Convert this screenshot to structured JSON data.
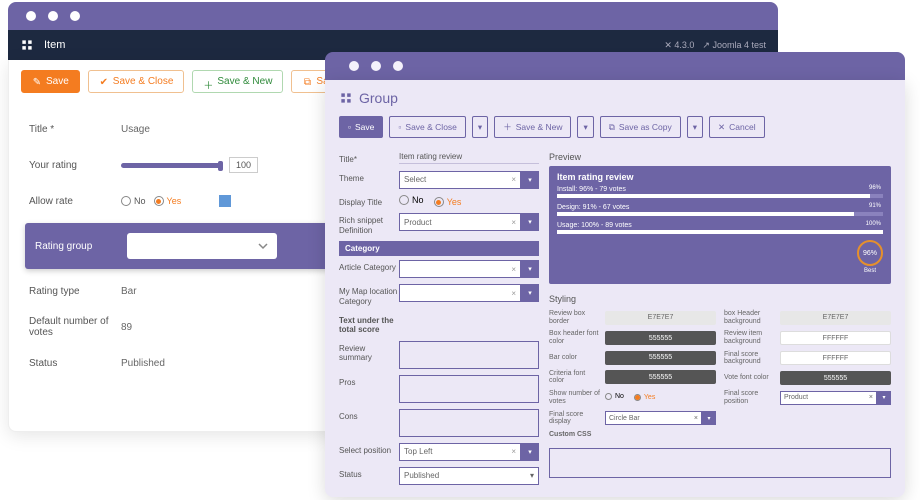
{
  "win1": {
    "header_title": "Item",
    "version": "4.3.0",
    "site_label": "Joomla 4 test",
    "toolbar": {
      "save": "Save",
      "save_close": "Save & Close",
      "save_new": "Save & New",
      "save_copy": "Save as Copy"
    },
    "form": {
      "title_lbl": "Title *",
      "title_val": "Usage",
      "rating_lbl": "Your rating",
      "rating_val": "100",
      "allow_lbl": "Allow rate",
      "no": "No",
      "yes": "Yes",
      "group_lbl": "Rating group",
      "type_lbl": "Rating type",
      "type_val": "Bar",
      "default_lbl": "Default number of votes",
      "default_val": "89",
      "status_lbl": "Status",
      "status_val": "Published"
    }
  },
  "win2": {
    "title": "Group",
    "toolbar": {
      "save": "Save",
      "save_close": "Save & Close",
      "save_new": "Save & New",
      "save_copy": "Save as Copy",
      "cancel": "Cancel"
    },
    "left": {
      "title_lbl": "Title*",
      "title_val": "Item rating review",
      "theme_lbl": "Theme",
      "theme_val": "Select",
      "disp_title_lbl": "Display Title",
      "no": "No",
      "yes": "Yes",
      "snippet_lbl": "Rich snippet Definition",
      "snippet_val": "Product",
      "category_hdr": "Category",
      "art_cat_lbl": "Article Category",
      "map_cat_lbl": "My Map location Category",
      "text_under_lbl": "Text under the total score",
      "summary_lbl": "Review summary",
      "pros_lbl": "Pros",
      "cons_lbl": "Cons",
      "selpos_lbl": "Select position",
      "selpos_val": "Top Left",
      "status_lbl": "Status",
      "status_val": "Published"
    },
    "preview": {
      "heading": "Preview",
      "title": "Item rating review",
      "rows": [
        {
          "label": "Install: 96% - 79 votes",
          "pct": "96%",
          "width": 96
        },
        {
          "label": "Design: 91% - 67 votes",
          "pct": "91%",
          "width": 91
        },
        {
          "label": "Usage: 100% - 89 votes",
          "pct": "100%",
          "width": 100
        }
      ],
      "gauge_val": "96%",
      "gauge_lbl": "Best"
    },
    "styling": {
      "heading": "Styling",
      "left": {
        "box_border_lbl": "Review box border",
        "box_border_val": "E7E7E7",
        "header_font_lbl": "Box header font color",
        "header_font_val": "555555",
        "bar_lbl": "Bar color",
        "bar_val": "555555",
        "criteria_lbl": "Criteria font color",
        "criteria_val": "555555",
        "show_votes_lbl": "Show number of votes",
        "no": "No",
        "yes": "Yes",
        "display_lbl": "Final score display",
        "display_val": "Circle Bar",
        "css_lbl": "Custom CSS"
      },
      "right": {
        "header_bg_lbl": "box Header background",
        "header_bg_val": "E7E7E7",
        "item_bg_lbl": "Review item background",
        "item_bg_val": "FFFFFF",
        "final_bg_lbl": "Final score background",
        "final_bg_val": "FFFFFF",
        "vote_font_lbl": "Vote font color",
        "vote_font_val": "555555",
        "final_pos_lbl": "Final score position",
        "final_pos_val": "Product"
      }
    }
  }
}
